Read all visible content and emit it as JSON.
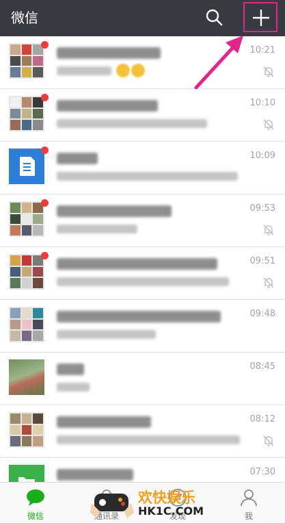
{
  "header": {
    "title": "微信",
    "search_icon": "search-icon",
    "add_icon": "plus-icon"
  },
  "colors": {
    "header_bg": "#393a3f",
    "accent_green": "#1aad19",
    "highlight_pink": "#e0268c",
    "unread_dot": "#f23c3c"
  },
  "chats": [
    {
      "time": "10:21",
      "muted": true,
      "unread": true,
      "avatar": "group-grid"
    },
    {
      "time": "10:10",
      "muted": true,
      "unread": true,
      "avatar": "group-grid"
    },
    {
      "time": "10:09",
      "muted": false,
      "unread": true,
      "avatar": "subscriptions-icon"
    },
    {
      "time": "09:53",
      "muted": true,
      "unread": true,
      "avatar": "group-grid"
    },
    {
      "time": "09:51",
      "muted": true,
      "unread": true,
      "avatar": "group-grid"
    },
    {
      "time": "09:48",
      "muted": false,
      "unread": false,
      "avatar": "group-grid"
    },
    {
      "time": "08:45",
      "muted": false,
      "unread": false,
      "avatar": "photo"
    },
    {
      "time": "08:12",
      "muted": true,
      "unread": false,
      "avatar": "group-grid"
    },
    {
      "time": "07:30",
      "muted": false,
      "unread": false,
      "avatar": "file-transfer-icon"
    }
  ],
  "tabs": [
    {
      "label": "微信",
      "icon": "chat-bubble-icon",
      "active": true
    },
    {
      "label": "通讯录",
      "icon": "contacts-icon",
      "active": false
    },
    {
      "label": "发现",
      "icon": "discover-icon",
      "active": false
    },
    {
      "label": "我",
      "icon": "person-icon",
      "active": false
    }
  ],
  "watermark": {
    "brand": "欢快娱乐",
    "site": "HK1C.COM"
  }
}
